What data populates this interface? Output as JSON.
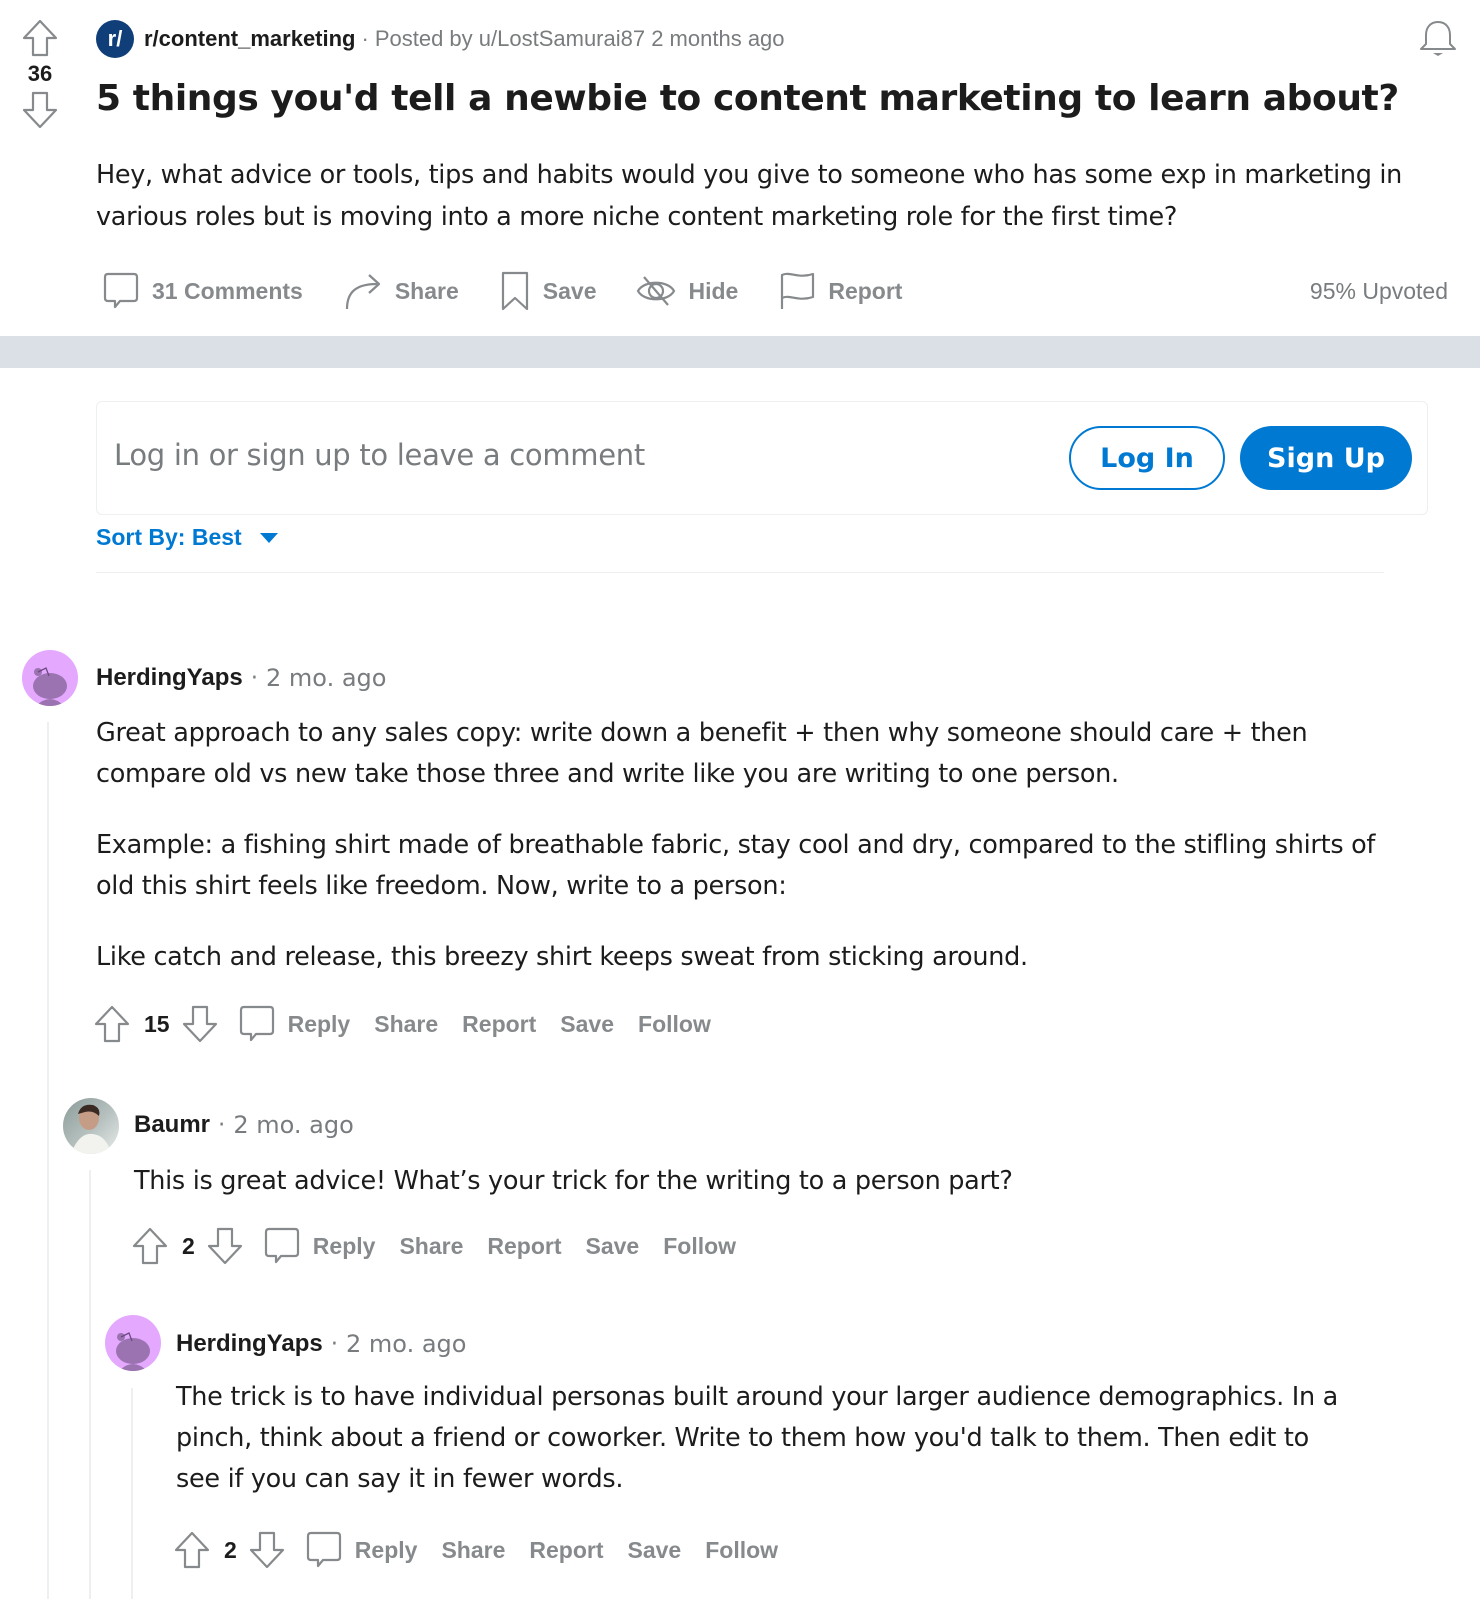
{
  "post": {
    "score": "36",
    "subreddit": "r/content_marketing",
    "subreddit_icon_text": "r/",
    "meta_separator": "·",
    "posted_by": "Posted by u/LostSamurai87 2 months ago",
    "title": "5 things you'd tell a newbie to content marketing to learn about?",
    "body": "Hey, what advice or tools, tips and habits would you give to someone who has some exp in marketing in various roles but is moving into a more niche content marketing role for the first time?",
    "actions": {
      "comments": "31 Comments",
      "share": "Share",
      "save": "Save",
      "hide": "Hide",
      "report": "Report"
    },
    "upvoted": "95% Upvoted"
  },
  "login_prompt": {
    "text": "Log in or sign up to leave a comment",
    "login_label": "Log In",
    "signup_label": "Sign Up"
  },
  "sort": {
    "label": "Sort By: Best"
  },
  "colors": {
    "accent": "#0079d3",
    "subreddit_icon": "#0f3e78",
    "snoo_avatar_bg": "#e4a8ff",
    "snoo_avatar_fg": "#9b73b0",
    "divider_band": "#dae0e6",
    "muted_text": "#878a8c"
  },
  "comments": [
    {
      "user": "HerdingYaps",
      "separator": "·",
      "time": "2 mo. ago",
      "avatar": "snoo",
      "paragraphs": [
        "Great approach to any sales copy: write down a benefit + then why someone should care + then compare old vs new take those three and write like you are writing to one person.",
        "Example: a fishing shirt made of breathable fabric, stay cool and dry, compared to the stifling shirts of old this shirt feels like freedom. Now, write to a person:",
        "Like catch and release, this breezy shirt keeps sweat from sticking around."
      ],
      "score": "15",
      "actions": {
        "reply": "Reply",
        "share": "Share",
        "report": "Report",
        "save": "Save",
        "follow": "Follow"
      }
    },
    {
      "user": "Baumr",
      "separator": "·",
      "time": "2 mo. ago",
      "avatar": "photo",
      "paragraphs": [
        "This is great advice! What’s your trick for the writing to a person part?"
      ],
      "score": "2",
      "actions": {
        "reply": "Reply",
        "share": "Share",
        "report": "Report",
        "save": "Save",
        "follow": "Follow"
      }
    },
    {
      "user": "HerdingYaps",
      "separator": "·",
      "time": "2 mo. ago",
      "avatar": "snoo",
      "paragraphs": [
        "The trick is to have individual personas built around your larger audience demographics. In a pinch, think about a friend or coworker. Write to them how you'd talk to them. Then edit to see if you can say it in fewer words."
      ],
      "score": "2",
      "actions": {
        "reply": "Reply",
        "share": "Share",
        "report": "Report",
        "save": "Save",
        "follow": "Follow"
      }
    }
  ]
}
